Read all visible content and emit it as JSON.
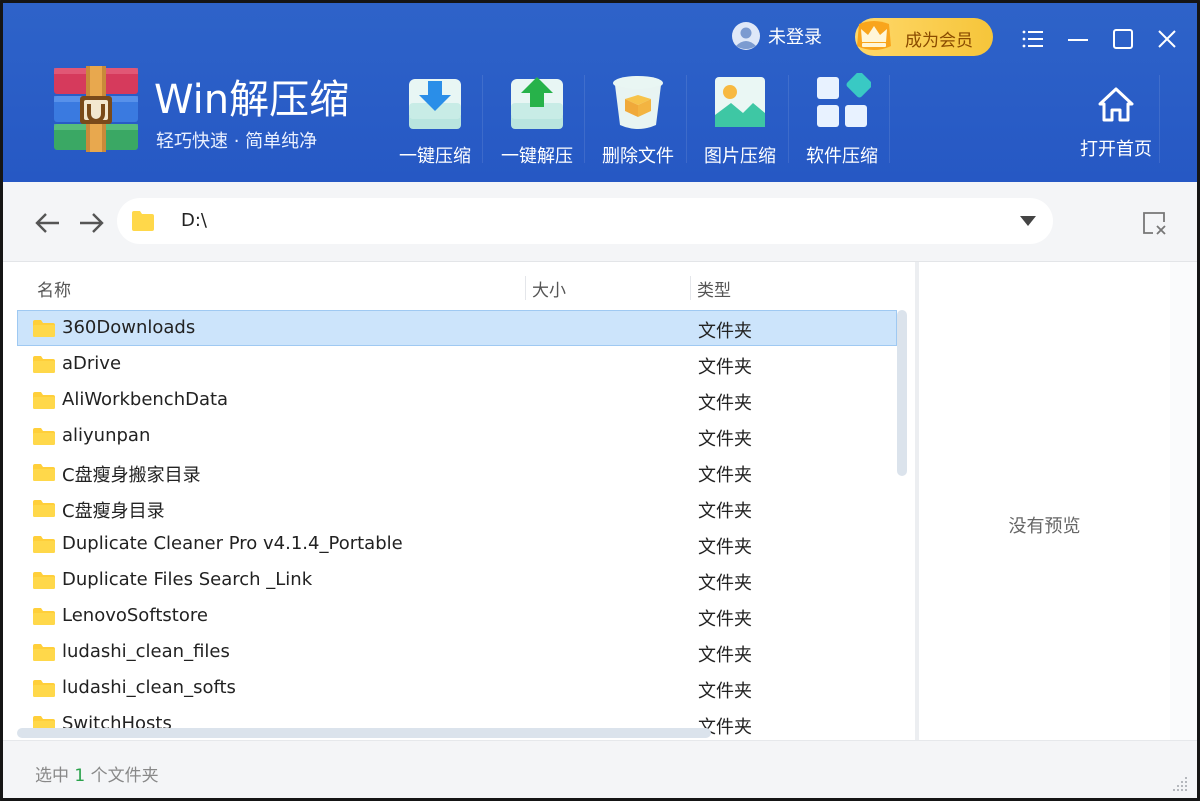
{
  "app": {
    "title": "Win解压缩",
    "subtitle": "轻巧快速 · 简单纯净"
  },
  "toolbar": {
    "items": [
      {
        "label": "一键压缩",
        "icon": "compress-icon"
      },
      {
        "label": "一键解压",
        "icon": "extract-icon"
      },
      {
        "label": "删除文件",
        "icon": "delete-icon"
      },
      {
        "label": "图片压缩",
        "icon": "image-compress-icon"
      },
      {
        "label": "软件压缩",
        "icon": "software-compress-icon"
      }
    ],
    "home_label": "打开首页"
  },
  "account": {
    "login_label": "未登录",
    "vip_label": "成为会员"
  },
  "address": {
    "path": "D:\\"
  },
  "columns": {
    "name": "名称",
    "size": "大小",
    "type": "类型"
  },
  "files": [
    {
      "name": "360Downloads",
      "size": "",
      "type": "文件夹",
      "selected": true
    },
    {
      "name": "aDrive",
      "size": "",
      "type": "文件夹"
    },
    {
      "name": "AliWorkbenchData",
      "size": "",
      "type": "文件夹"
    },
    {
      "name": "aliyunpan",
      "size": "",
      "type": "文件夹"
    },
    {
      "name": "C盘瘦身搬家目录",
      "size": "",
      "type": "文件夹"
    },
    {
      "name": "C盘瘦身目录",
      "size": "",
      "type": "文件夹"
    },
    {
      "name": "Duplicate Cleaner Pro v4.1.4_Portable",
      "size": "",
      "type": "文件夹"
    },
    {
      "name": "Duplicate Files Search _Link",
      "size": "",
      "type": "文件夹"
    },
    {
      "name": "LenovoSoftstore",
      "size": "",
      "type": "文件夹"
    },
    {
      "name": "ludashi_clean_files",
      "size": "",
      "type": "文件夹"
    },
    {
      "name": "ludashi_clean_softs",
      "size": "",
      "type": "文件夹"
    },
    {
      "name": "SwitchHosts",
      "size": "",
      "type": "文件夹"
    }
  ],
  "preview": {
    "empty_text": "没有预览"
  },
  "status": {
    "prefix": "选中",
    "count": "1",
    "suffix": "个文件夹"
  },
  "colors": {
    "header": "#2658c4",
    "selection": "#cce4fb",
    "vip": "#f6c53a",
    "status_count": "#2ba24c"
  }
}
